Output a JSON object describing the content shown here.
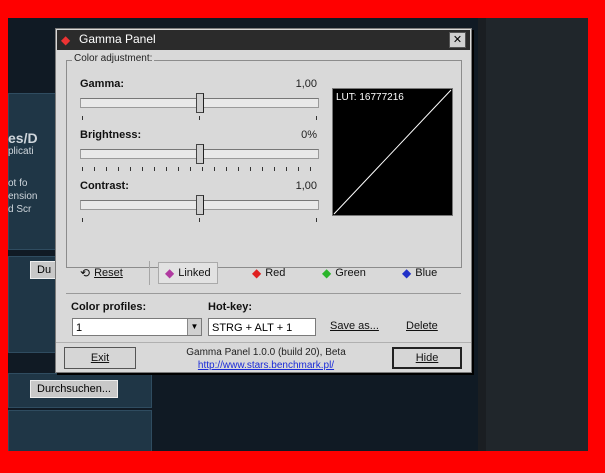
{
  "window": {
    "title": "Gamma Panel",
    "close_glyph": "✕"
  },
  "background": {
    "left_texts": [
      "es/D",
      "plicati",
      "ot fo",
      "ension",
      "d Scr"
    ],
    "button_partial": "Du",
    "browse_button": "Durchsuchen..."
  },
  "group": {
    "label": "Color adjustment:"
  },
  "sliders": [
    {
      "label": "Gamma:",
      "value": "1,00",
      "position": 0.5
    },
    {
      "label": "Brightness:",
      "value": "0%",
      "position": 0.5
    },
    {
      "label": "Contrast:",
      "value": "1,00",
      "position": 0.5
    }
  ],
  "lut": {
    "label": "LUT: 16777216"
  },
  "channels": {
    "reset": {
      "label": "Reset",
      "icon": "reset-arrows-icon"
    },
    "linked": {
      "label": "Linked",
      "icon": "rgb-diamonds-icon"
    },
    "red": {
      "label": "Red",
      "icon": "red-diamond-icon",
      "color": "#e02020"
    },
    "green": {
      "label": "Green",
      "icon": "green-diamond-icon",
      "color": "#2bb52b"
    },
    "blue": {
      "label": "Blue",
      "icon": "blue-diamond-icon",
      "color": "#2030c8"
    }
  },
  "profiles": {
    "label": "Color profiles:",
    "value": "1"
  },
  "hotkey": {
    "label": "Hot-key:",
    "value": "STRG + ALT + 1"
  },
  "actions": {
    "save_as": "Save as...",
    "delete": "Delete"
  },
  "footer": {
    "exit": "Exit",
    "hide": "Hide",
    "version": "Gamma Panel 1.0.0 (build 20), Beta",
    "url": "http://www.stars.benchmark.pl/"
  }
}
